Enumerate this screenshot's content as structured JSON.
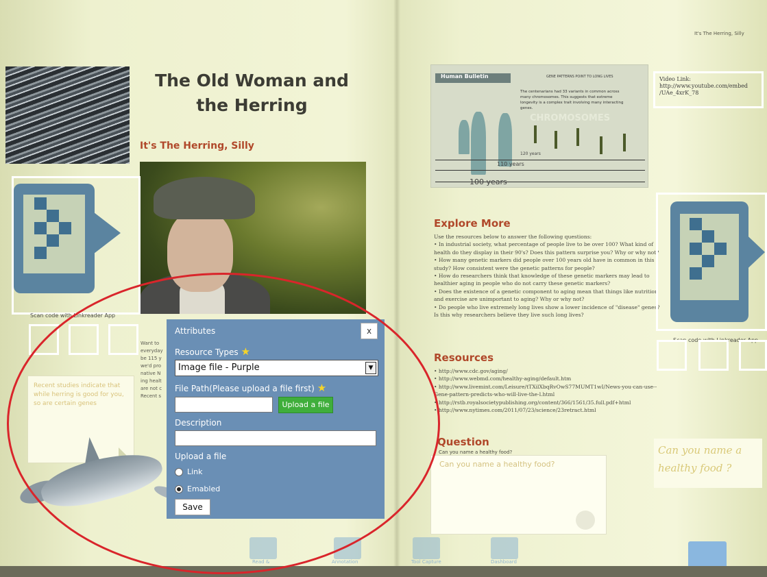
{
  "left_page": {
    "title_line1": "The Old Woman and",
    "title_line2": "the Herring",
    "subtitle": "It's The Herring, Silly",
    "scan_label": "Scan code with Linkreader App",
    "body_fragments": [
      "Want to",
      "everyday",
      "be 115 y",
      "we'd pro",
      "native N",
      "ing healt",
      "are not c",
      "Recent s"
    ],
    "sticky_note": "Recent studies indicate that while herring is good for you, so are certain genes"
  },
  "attributes_dialog": {
    "header": "Attributes",
    "close_label": "x",
    "resource_types_label": "Resource Types",
    "resource_type_selected": "Image file - Purple",
    "file_path_label": "File Path(Please upload a file first)",
    "file_path_value": "",
    "upload_label": "Upload a file",
    "description_label": "Description",
    "description_value": "",
    "upload_section_label": "Upload a file",
    "options": [
      {
        "label": "Link",
        "selected": false
      },
      {
        "label": "Emabled",
        "selected": true
      }
    ],
    "save_label": "Save"
  },
  "right_page": {
    "running_head": "It's The Herring, Silly",
    "infographic": {
      "brand": "Human Bulletin",
      "headline": "GENE PATTERNS POINT TO LONG LIVES",
      "text": "The centenarians had 33 variants in common across many chromosomes. This suggests that extreme longevity is a complex trait involving many interacting genes.",
      "chromosomes_label": "CHROMOSOMES",
      "years": [
        "120 years",
        "110 years",
        "100 years"
      ]
    },
    "video": {
      "label": "Video Link:",
      "url_line1": "http://www.youtube.com/embed",
      "url_line2": "/UAe_4xrK_78"
    },
    "explore_heading": "Explore More",
    "explore_text": [
      "Use the resources below to answer the following questions:",
      "• In industrial society, what percentage of people live to be over 100? What kind of health do they display in their 90's? Does this pattern surprise you? Why or why not?",
      "• How many genetic markers did people over 100 years old have in common in this study? How consistent were the genetic patterns for people?",
      "• How do researchers think that knowledge of these genetic markers may lead to healthier aging in people who do not carry these genetic markers?",
      "• Does the existence of a genetic component to aging mean that things like nutrition and exercise are unimportant to aging? Why or why not?",
      "• Do people who live extremely long lives show a lower incidence of \"disease\" genes? Is this why researchers believe they live such long lives?"
    ],
    "resources_heading": "Resources",
    "resources": [
      "• http://www.cdc.gov/aging/",
      "• http://www.webmd.com/healthy-aging/default.htm",
      "• http://www.livemint.com/Leisure/tTXilXbqRvOwS77MUMT1wI/News-you-can-use--Gene-pattern-predicts-who-will-live-the-l.html",
      "• http://rstb.royalsocietypublishing.org/content/366/1561/35.full.pdf+html",
      "• http://www.nytimes.com/2011/07/23/science/23retract.html"
    ],
    "question_heading": "Question",
    "question_sub": "Can you name a healthy food?",
    "answer_typed": "Can you name a healthy food?",
    "handwriting": "Can you name a healthy food ?",
    "scan_label": "Scan code with Linkreader App"
  },
  "toolbar": {
    "items": [
      "Read &",
      "Annotation",
      "Tool Capture",
      "Dashboard"
    ]
  },
  "colors": {
    "dialog_bg": "#6a8fb5",
    "upload_button": "#3fae3b",
    "heading_red": "#b0482a",
    "annotation_red": "#d9252b"
  }
}
